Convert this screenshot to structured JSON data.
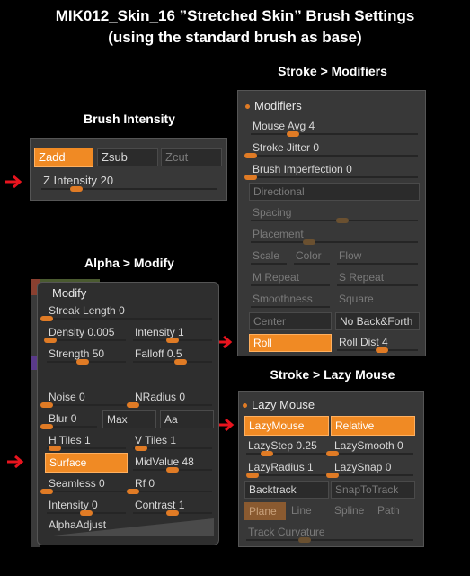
{
  "title_line1": "MIK012_Skin_16 ”Stretched Skin” Brush Settings",
  "title_line2": "(using the standard brush as base)",
  "colors": {
    "accent": "#f08a24",
    "panel": "#383838",
    "arrow": "#e8141e"
  },
  "brush_intensity": {
    "section": "Brush Intensity",
    "zadd": "Zadd",
    "zsub": "Zsub",
    "zcut": "Zcut",
    "z_intensity": {
      "label": "Z Intensity",
      "value": "20",
      "level": 0.2
    }
  },
  "stroke_modifiers": {
    "section": "Stroke > Modifiers",
    "header": "Modifiers",
    "mouse_avg": {
      "label": "Mouse Avg",
      "value": "4",
      "level": 0.25
    },
    "stroke_jitter": {
      "label": "Stroke Jitter",
      "value": "0",
      "level": 0
    },
    "brush_imperfection": {
      "label": "Brush Imperfection",
      "value": "0",
      "level": 0
    },
    "directional": "Directional",
    "spacing": {
      "label": "Spacing",
      "level": 0.55
    },
    "placement": {
      "label": "Placement",
      "level": 0.35
    },
    "scale": "Scale",
    "color": "Color",
    "flow": "Flow",
    "m_repeat": "M Repeat",
    "s_repeat": "S Repeat",
    "smoothness": "Smoothness",
    "square": "Square",
    "center": "Center",
    "no_back_forth": "No Back&Forth",
    "roll": "Roll",
    "roll_dist": {
      "label": "Roll Dist",
      "value": "4",
      "level": 0.55
    }
  },
  "alpha_modify": {
    "section": "Alpha > Modify",
    "tab": "Modify",
    "streak_length": {
      "label": "Streak Length",
      "value": "0",
      "level": 0
    },
    "density": {
      "label": "Density",
      "value": "0.005",
      "level": 0.05
    },
    "intensity_right": {
      "label": "Intensity",
      "value": "1",
      "level": 0.5
    },
    "strength": {
      "label": "Strength",
      "value": "50",
      "level": 0.45
    },
    "falloff": {
      "label": "Falloff",
      "value": "0.5",
      "level": 0.6
    },
    "noise": {
      "label": "Noise",
      "value": "0",
      "level": 0
    },
    "nradius": {
      "label": "NRadius",
      "value": "0",
      "level": 0
    },
    "blur": {
      "label": "Blur",
      "value": "0",
      "level": 0
    },
    "max": "Max",
    "aa": "Aa",
    "h_tiles": {
      "label": "H Tiles",
      "value": "1",
      "level": 0.1
    },
    "v_tiles": {
      "label": "V Tiles",
      "value": "1",
      "level": 0.1
    },
    "surface": "Surface",
    "midvalue": {
      "label": "MidValue",
      "value": "48",
      "level": 0.5
    },
    "seamless": {
      "label": "Seamless",
      "value": "0",
      "level": 0
    },
    "rf": {
      "label": "Rf",
      "value": "0",
      "level": 0
    },
    "intensity_bottom": {
      "label": "Intensity",
      "value": "0",
      "level": 0.5
    },
    "contrast": {
      "label": "Contrast",
      "value": "1",
      "level": 0.5
    },
    "alpha_adjust": "AlphaAdjust"
  },
  "lazy_mouse": {
    "section": "Stroke > Lazy Mouse",
    "header": "Lazy Mouse",
    "lazymouse": "LazyMouse",
    "relative": "Relative",
    "lazystep": {
      "label": "LazyStep",
      "value": "0.25",
      "level": 0.25
    },
    "lazysmooth": {
      "label": "LazySmooth",
      "value": "0",
      "level": 0
    },
    "lazyradius": {
      "label": "LazyRadius",
      "value": "1",
      "level": 0.08
    },
    "lazysnap": {
      "label": "LazySnap",
      "value": "0",
      "level": 0
    },
    "backtrack": "Backtrack",
    "snaptotrack": "SnapToTrack",
    "plane": "Plane",
    "line": "Line",
    "spline": "Spline",
    "path": "Path",
    "track_curvature": {
      "label": "Track Curvature",
      "level": 0.35
    }
  }
}
